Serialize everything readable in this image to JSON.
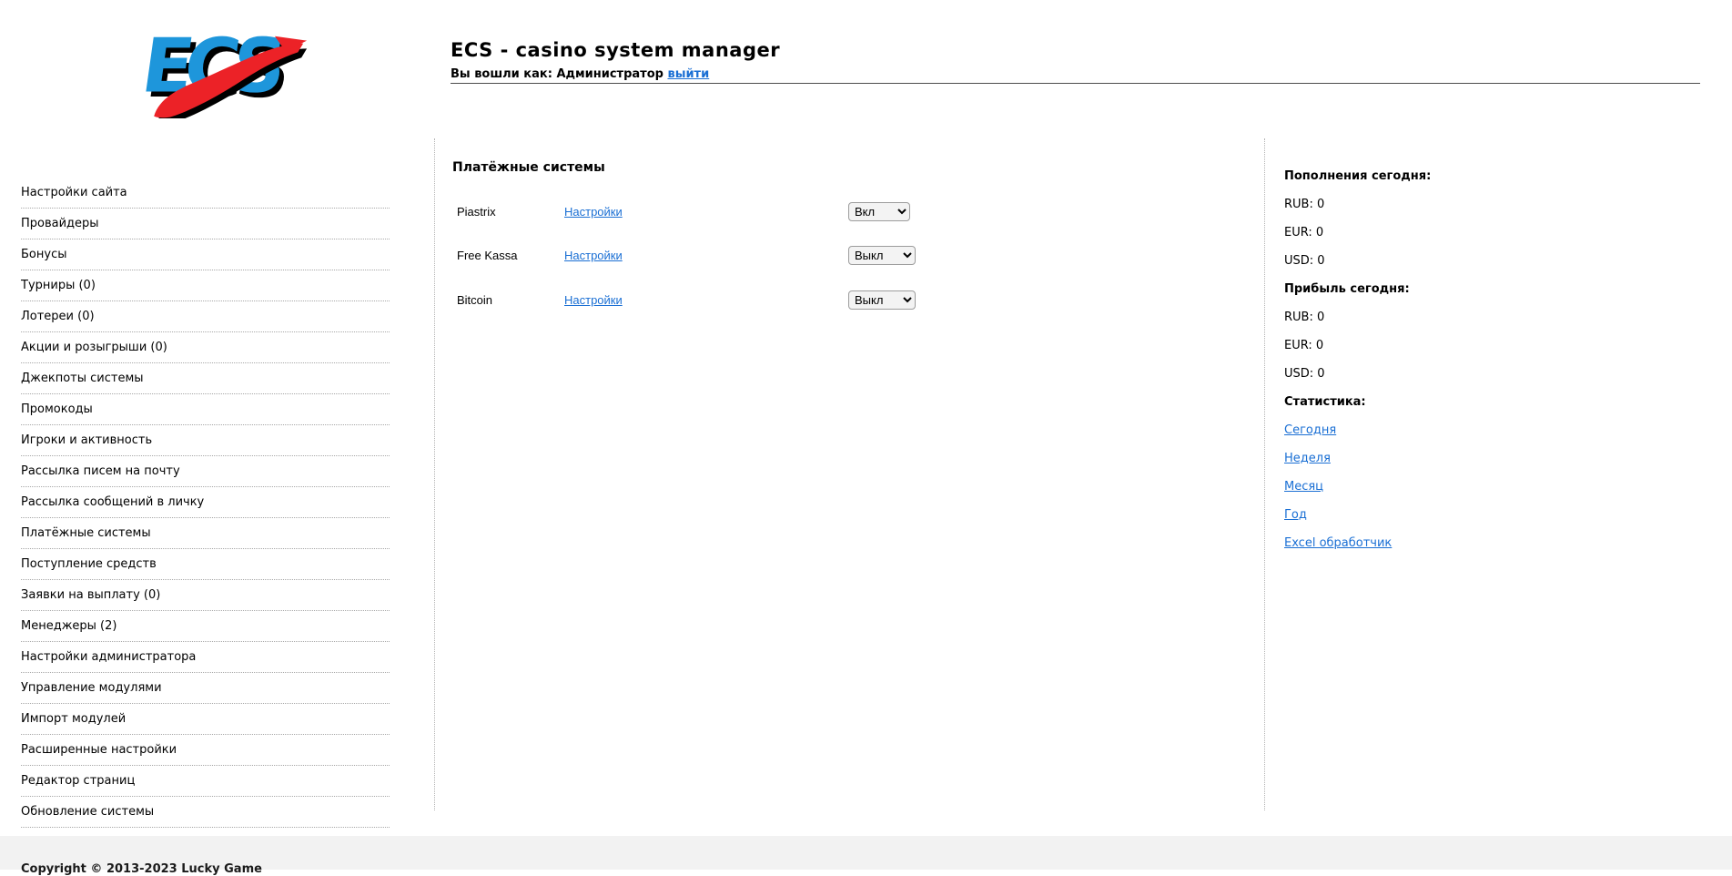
{
  "header": {
    "logo_text": "ECS",
    "title": "ECS - casino system manager",
    "login_prefix": "Вы вошли как: Администратор",
    "logout_label": "выйти"
  },
  "sidebar": {
    "items": [
      "Настройки сайта",
      "Провайдеры",
      "Бонусы",
      "Турниры (0)",
      "Лотереи (0)",
      "Акции и розыгрыши (0)",
      "Джекпоты системы",
      "Промокоды",
      "Игроки и активность",
      "Рассылка писем на почту",
      "Рассылка сообщений в личку",
      "Платёжные системы",
      "Поступление средств",
      "Заявки на выплату (0)",
      "Менеджеры (2)",
      "Настройки администратора",
      "Управление модулями",
      "Импорт модулей",
      "Расширенные настройки",
      "Редактор страниц",
      "Обновление системы"
    ]
  },
  "main": {
    "heading": "Платёжные системы",
    "settings_label": "Настройки",
    "status_options": [
      "Вкл",
      "Выкл"
    ],
    "rows": [
      {
        "name": "Piastrix",
        "status": "Вкл"
      },
      {
        "name": "Free Kassa",
        "status": "Выкл"
      },
      {
        "name": "Bitcoin",
        "status": "Выкл"
      }
    ]
  },
  "stats": {
    "deposits_heading": "Пополнения сегодня:",
    "deposits": [
      "RUB: 0",
      "EUR: 0",
      "USD: 0"
    ],
    "profit_heading": "Прибыль сегодня:",
    "profit": [
      "RUB: 0",
      "EUR: 0",
      "USD: 0"
    ],
    "stats_heading": "Статистика:",
    "links": [
      "Сегодня",
      "Неделя",
      "Месяц",
      "Год",
      "Excel обработчик"
    ]
  },
  "footer": {
    "copyright": "Copyright © 2013-2023 Lucky Game"
  },
  "colors": {
    "link_blue": "#1a6fd4",
    "logo_blue": "#1e96db",
    "logo_red": "#ec2227",
    "footer_bg": "#f2f2f2"
  }
}
